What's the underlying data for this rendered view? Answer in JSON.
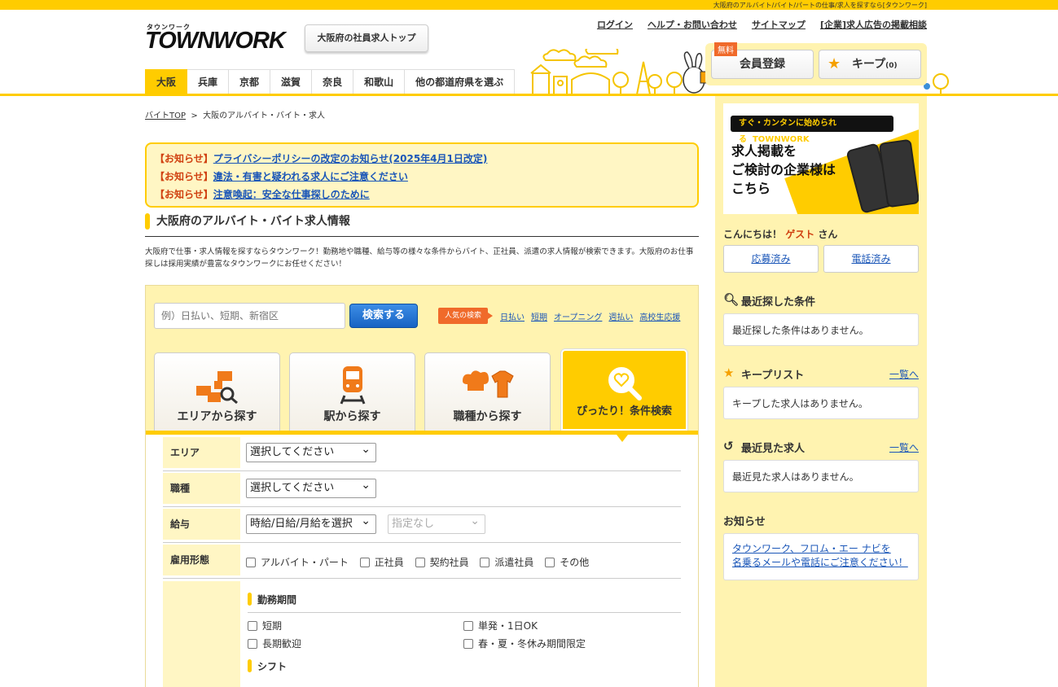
{
  "topbar": {
    "tagline": "大阪府のアルバイト/バイト/パートの仕事/求人を探すなら[タウンワーク]"
  },
  "logo": {
    "small": "タウンワーク",
    "big": "TOWNWORK"
  },
  "header": {
    "top_button": "大阪府の社員求人トップ",
    "links": [
      "ログイン",
      "ヘルプ・お問い合わせ",
      "サイトマップ",
      "[企業]求人広告の掲載相談"
    ],
    "register_badge": "無料",
    "register_label": "会員登録",
    "keep_label": "キープ",
    "keep_count": "(0)"
  },
  "pref_tabs": [
    "大阪",
    "兵庫",
    "京都",
    "滋賀",
    "奈良",
    "和歌山",
    "他の都道府県を選ぶ"
  ],
  "breadcrumb": {
    "home": "バイトTOP",
    "sep": ">",
    "current": "大阪のアルバイト・バイト・求人"
  },
  "notices": [
    {
      "tag": "【お知らせ】",
      "text": "プライバシーポリシーの改定のお知らせ(2025年4月1日改定)"
    },
    {
      "tag": "【お知らせ】",
      "text": "違法・有害と疑われる求人にご注意ください"
    },
    {
      "tag": "【お知らせ】",
      "text": "注意喚起：安全な仕事探しのために"
    }
  ],
  "section": {
    "title": "大阪府のアルバイト・バイト求人情報",
    "desc": "大阪府で仕事・求人情報を探すならタウンワーク！勤務地や職種、給与等の様々な条件からバイト、正社員、派遣の求人情報が検索できます。大阪府のお仕事探しは採用実績が豊富なタウンワークにお任せください！"
  },
  "search": {
    "placeholder": "例）日払い、短期、新宿区",
    "button": "検索する",
    "popular_label": "人気の検索",
    "popular": [
      "日払い",
      "短期",
      "オープニング",
      "週払い",
      "高校生応援"
    ]
  },
  "category_tabs": [
    "エリアから探す",
    "駅から探す",
    "職種から探す",
    "ぴったり！条件検索"
  ],
  "form": {
    "area_label": "エリア",
    "area_value": "選択してください",
    "job_label": "職種",
    "job_value": "選択してください",
    "salary_label": "給与",
    "salary_value": "時給/日給/月給を選択",
    "salary_value2": "指定なし",
    "employment_label": "雇用形態",
    "employment_options": [
      "アルバイト・パート",
      "正社員",
      "契約社員",
      "派遣社員",
      "その他"
    ],
    "period_heading": "勤務期間",
    "period_options": [
      "短期",
      "単発・1日OK",
      "長期歓迎",
      "春・夏・冬休み期間限定"
    ],
    "shift_heading": "シフト"
  },
  "sidebar": {
    "banner_strip": "すぐ・カンタンに始められる",
    "banner_brand": "TOWNWORK",
    "banner_text": [
      "求人掲載を",
      "ご検討の企業様は",
      "こちら"
    ],
    "greet_prefix": "こんにちは！",
    "greet_name": "ゲスト",
    "greet_suffix": "さん",
    "applied": "応募済み",
    "called": "電話済み",
    "recent_search_title": "最近探した条件",
    "recent_search_empty": "最近探した条件はありません。",
    "keep_title": "キープリスト",
    "keep_more": "一覧へ",
    "keep_empty": "キープした求人はありません。",
    "viewed_title": "最近見た求人",
    "viewed_more": "一覧へ",
    "viewed_empty": "最近見た求人はありません。",
    "news_title": "お知らせ",
    "news_link": [
      "タウンワーク、フロム・エー ナビを",
      "名乗るメールや電話にご注意ください！"
    ]
  },
  "colors": {
    "brand": "#ffcc00",
    "panel": "#fff3b0",
    "accent": "#f06a2a",
    "link": "#1a56b8"
  }
}
